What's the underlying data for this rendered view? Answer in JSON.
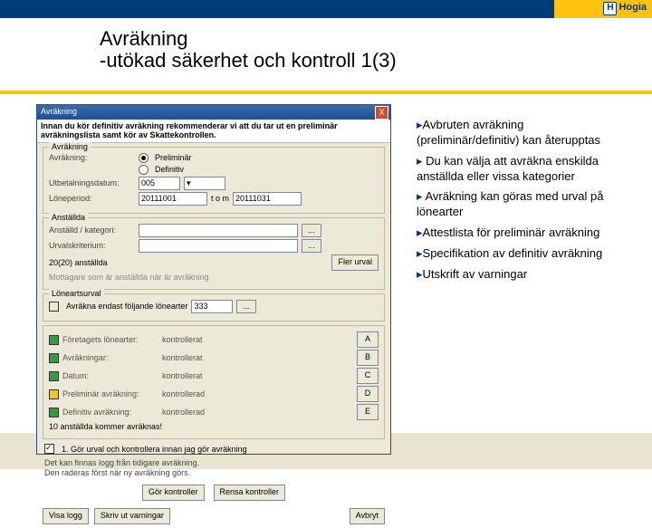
{
  "brand": "Hogia",
  "slide": {
    "title_line1": "Avräkning",
    "title_line2": "-utökad säkerhet och kontroll 1(3)"
  },
  "dialog": {
    "titlebar": "Avräkning",
    "close_glyph": "X",
    "banner": "Innan du kör definitiv avräkning rekommenderar vi att du tar ut en preliminär avräkningslista samt kör av Skattekontrollen.",
    "group_avrakning": {
      "legend": "Avräkning",
      "label_avrakning": "Avräkning:",
      "radio1": "Preliminär",
      "radio2": "Definitiv",
      "label_utbet": "Utbetalningsdatum:",
      "val_utbet": "005",
      "label_loneperiod": "Löneperiod:",
      "val_loneperiod": "20111001",
      "label_tom": "t o m",
      "val_tom": "20111031"
    },
    "group_anst": {
      "legend": "Anställda",
      "label_kat": "Anställd / kategori:",
      "label_urval": "Urvalskriterium:",
      "count_text": "20(20) anställda",
      "btn_flerurv": "Fler urval",
      "note": "Mottagare som är anställda när är avräkning"
    },
    "group_loneart": {
      "legend": "Löneartsurval",
      "chk_label": "Avräkna endast följande lönearter",
      "val": "333"
    },
    "status": [
      {
        "color": "g",
        "label": "Företagets lönearter:",
        "value": "kontrollerat",
        "mini": "A"
      },
      {
        "color": "g",
        "label": "Avräkningar:",
        "value": "kontrollerat",
        "mini": "B"
      },
      {
        "color": "g",
        "label": "Datum:",
        "value": "kontrollerat",
        "mini": "C"
      },
      {
        "color": "y",
        "label": "Preliminär avräkning:",
        "value": "kontrollerad",
        "mini": "D"
      },
      {
        "color": "g",
        "label": "Definitiv avräkning:",
        "value": "kontrollerad",
        "mini": "E"
      }
    ],
    "status_footer": "10 anställda kommer avräknas!",
    "chk_inst": "1. Gör urval och kontrollera innan jag gör avräkning",
    "warn_lines": "Det kan finnas logg från tidigare avräkning.\nDen raderas först när ny avräkning görs.",
    "btn_gor": "Gör kontroller",
    "btn_rensa": "Rensa kontroller",
    "btn_visa": "Visa logg",
    "btn_skriv": "Skriv ut varningar",
    "btn_avbryt": "Avbryt"
  },
  "bullets": [
    "Avbruten avräkning (preliminär/definitiv) kan återupptas",
    "Du kan välja att avräkna enskilda anställda eller vissa kategorier",
    "Avräkning kan göras med urval på lönearter",
    "Attestlista för preliminär avräkning",
    "Specifikation av definitiv avräkning",
    "Utskrift av varningar"
  ]
}
